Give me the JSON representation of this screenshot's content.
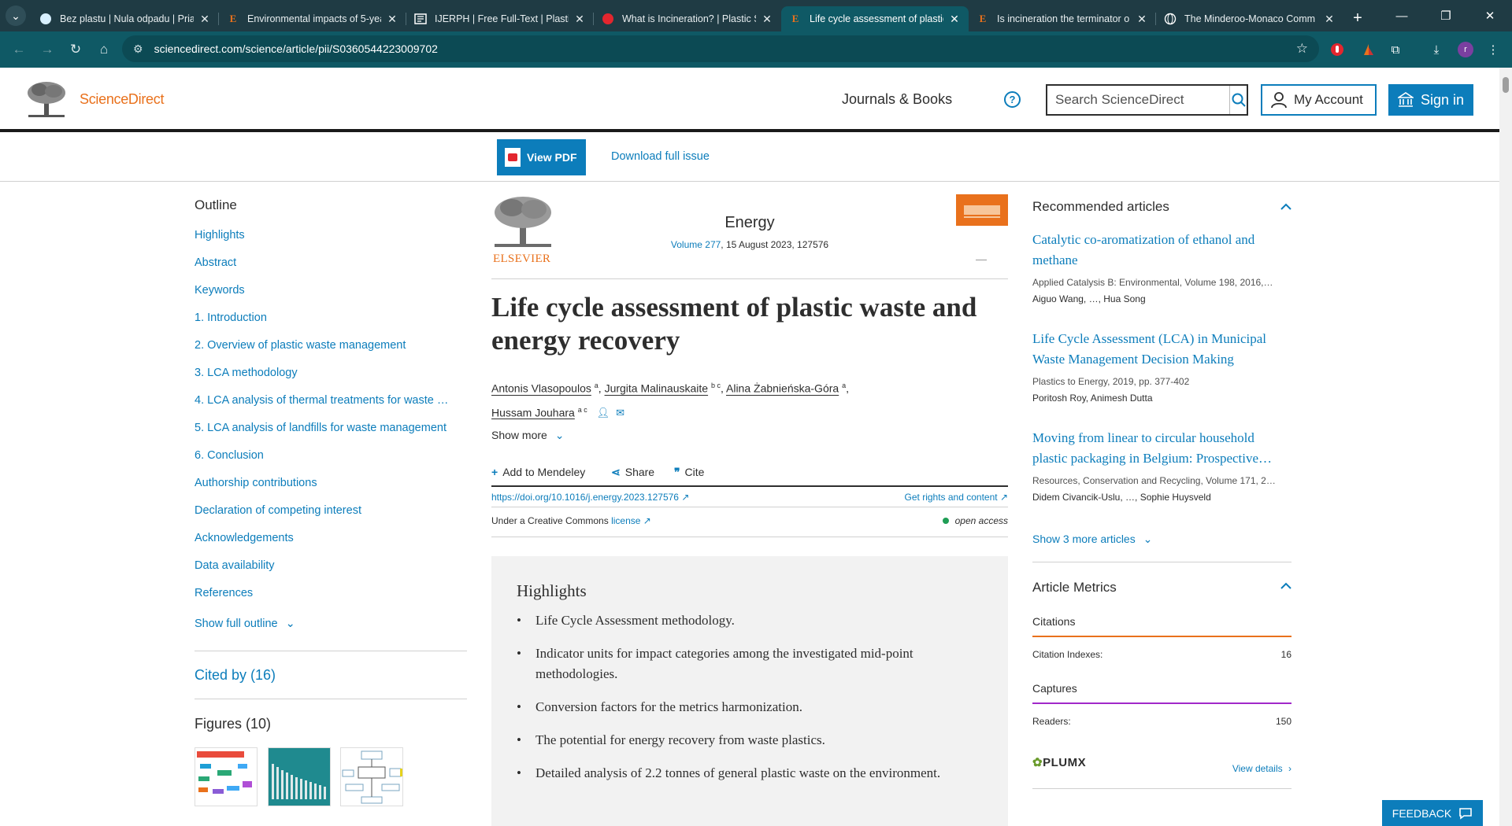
{
  "browser": {
    "tabs": [
      {
        "title": "Bez plastu | Nula odpadu | Priat",
        "favicon": "bubble-icon",
        "active": false
      },
      {
        "title": "Environmental impacts of 5-yea",
        "favicon": "elsevier-e-icon",
        "active": false
      },
      {
        "title": "IJERPH | Free Full-Text | Plastic W",
        "favicon": "mdpi-icon",
        "active": false
      },
      {
        "title": "What is Incineration? | Plastic So",
        "favicon": "red-circle-icon",
        "active": false
      },
      {
        "title": "Life cycle assessment of plastic",
        "favicon": "elsevier-e-icon",
        "active": true
      },
      {
        "title": "Is incineration the terminator o",
        "favicon": "elsevier-e-icon",
        "active": false
      },
      {
        "title": "The Minderoo-Monaco Comm",
        "favicon": "globe-icon",
        "active": false
      }
    ],
    "url": "sciencedirect.com/science/article/pii/S0360544223009702",
    "profile_initial": "r"
  },
  "header": {
    "brand": "ScienceDirect",
    "nav_journals": "Journals & Books",
    "help": "?",
    "search_placeholder": "Search ScienceDirect",
    "my_account": "My Account",
    "sign_in": "Sign in"
  },
  "pdfbar": {
    "view_pdf": "View PDF",
    "download_issue": "Download full issue"
  },
  "outline": {
    "heading": "Outline",
    "items": [
      "Highlights",
      "Abstract",
      "Keywords",
      "1. Introduction",
      "2. Overview of plastic waste management",
      "3. LCA methodology",
      "4. LCA analysis of thermal treatments for waste …",
      "5. LCA analysis of landfills for waste management",
      "6. Conclusion",
      "Authorship contributions",
      "Declaration of competing interest",
      "Acknowledgements",
      "Data availability",
      "References"
    ],
    "show_full": "Show full outline",
    "cited_by": "Cited by (16)",
    "figures": "Figures (10)"
  },
  "article": {
    "publisher": "ELSEVIER",
    "journal": "Energy",
    "volume": "Volume 277",
    "date_page": ", 15 August 2023, 127576",
    "title": "Life cycle assessment of plastic waste and energy recovery",
    "authors": [
      {
        "name": "Antonis Vlasopoulos",
        "sup": "a"
      },
      {
        "name": "Jurgita Malinauskaite",
        "sup": "b c"
      },
      {
        "name": "Alina Żabnieńska-Góra",
        "sup": "a"
      },
      {
        "name": "Hussam Jouhara",
        "sup": "a c"
      }
    ],
    "show_more": "Show more",
    "actions": {
      "mendeley": "Add to Mendeley",
      "share": "Share",
      "cite": "Cite"
    },
    "doi": "https://doi.org/10.1016/j.energy.2023.127576",
    "rights": "Get rights and content",
    "license_prefix": "Under a Creative Commons",
    "license_link": "license",
    "access": "open access",
    "highlights_heading": "Highlights",
    "highlights": [
      "Life Cycle Assessment methodology.",
      "Indicator units for impact categories among the investigated mid-point methodologies.",
      "Conversion factors for the metrics harmonization.",
      "The potential for energy recovery from waste plastics.",
      "Detailed analysis of 2.2 tonnes of general plastic waste on the environment."
    ]
  },
  "sidebar": {
    "recommended_heading": "Recommended articles",
    "recommended": [
      {
        "title": "Catalytic co-aromatization of ethanol and methane",
        "source": "Applied Catalysis B: Environmental, Volume 198, 2016,…",
        "authors": "Aiguo Wang, …, Hua Song"
      },
      {
        "title": "Life Cycle Assessment (LCA) in Municipal Waste Management Decision Making",
        "source": "Plastics to Energy, 2019, pp. 377-402",
        "authors": "Poritosh Roy, Animesh Dutta"
      },
      {
        "title": "Moving from linear to circular household plastic packaging in Belgium: Prospective…",
        "source": "Resources, Conservation and Recycling, Volume 171, 2…",
        "authors": "Didem Civancik-Uslu, …, Sophie Huysveld"
      }
    ],
    "show_more_articles": "Show 3 more articles",
    "metrics_heading": "Article Metrics",
    "citations_label": "Citations",
    "citation_indexes_label": "Citation Indexes:",
    "citation_indexes_value": "16",
    "captures_label": "Captures",
    "readers_label": "Readers:",
    "readers_value": "150",
    "plumx": "PLUMX",
    "view_details": "View details"
  },
  "feedback": "FEEDBACK",
  "colors": {
    "brand_orange": "#e9711c",
    "link_blue": "#0c7dbb",
    "chrome_dark": "#1f3b44",
    "chrome_teal": "#0f5965",
    "citations_bar": "#e9711c",
    "captures_bar": "#a128c9"
  }
}
